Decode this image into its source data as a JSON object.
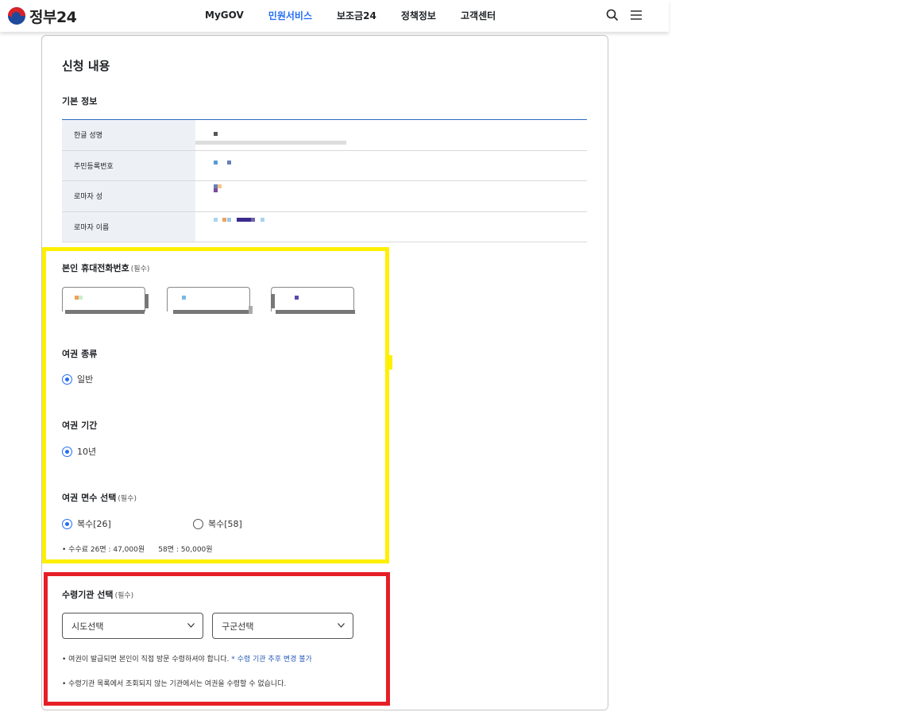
{
  "header": {
    "logo_text": "정부24",
    "nav": [
      "MyGOV",
      "민원서비스",
      "보조금24",
      "정책정보",
      "고객센터"
    ],
    "active_nav": "민원서비스",
    "icons": [
      "search-icon",
      "menu-icon"
    ],
    "accent_color": "#256ef4"
  },
  "form": {
    "title": "신청 내용",
    "basic_info": {
      "label": "기본 정보",
      "rows": [
        "한글 성명",
        "주민등록번호",
        "로마자 성",
        "로마자 이름"
      ]
    },
    "phone": {
      "label": "본인 휴대전화번호",
      "required": "(필수)"
    },
    "passport_type": {
      "label": "여권 종류",
      "option": "일반",
      "selected": true
    },
    "passport_period": {
      "label": "여권 기간",
      "option": "10년",
      "selected": true
    },
    "page_count": {
      "label": "여권 면수 선택",
      "required": "(필수)",
      "options": [
        "복수[26]",
        "복수[58]"
      ],
      "selected": "복수[26]",
      "fee_note": "• 수수료 26면 : 47,000원      58면 : 50,000원"
    },
    "pickup": {
      "label": "수령기관 선택",
      "required": "(필수)",
      "sido_placeholder": "시도선택",
      "gugun_placeholder": "구군선택",
      "note1": "• 여권이 발급되면 본인이 직접 방문 수령하셔야 합니다. ",
      "note1_emphasis": "* 수령 기관 추후 변경 불가",
      "note2": "• 수령기관 목록에서 조회되지 않는 기관에서는 여권을 수령할 수 없습니다."
    }
  },
  "highlight_colors": {
    "yellow": "#ffef00",
    "red": "#e61e26"
  }
}
